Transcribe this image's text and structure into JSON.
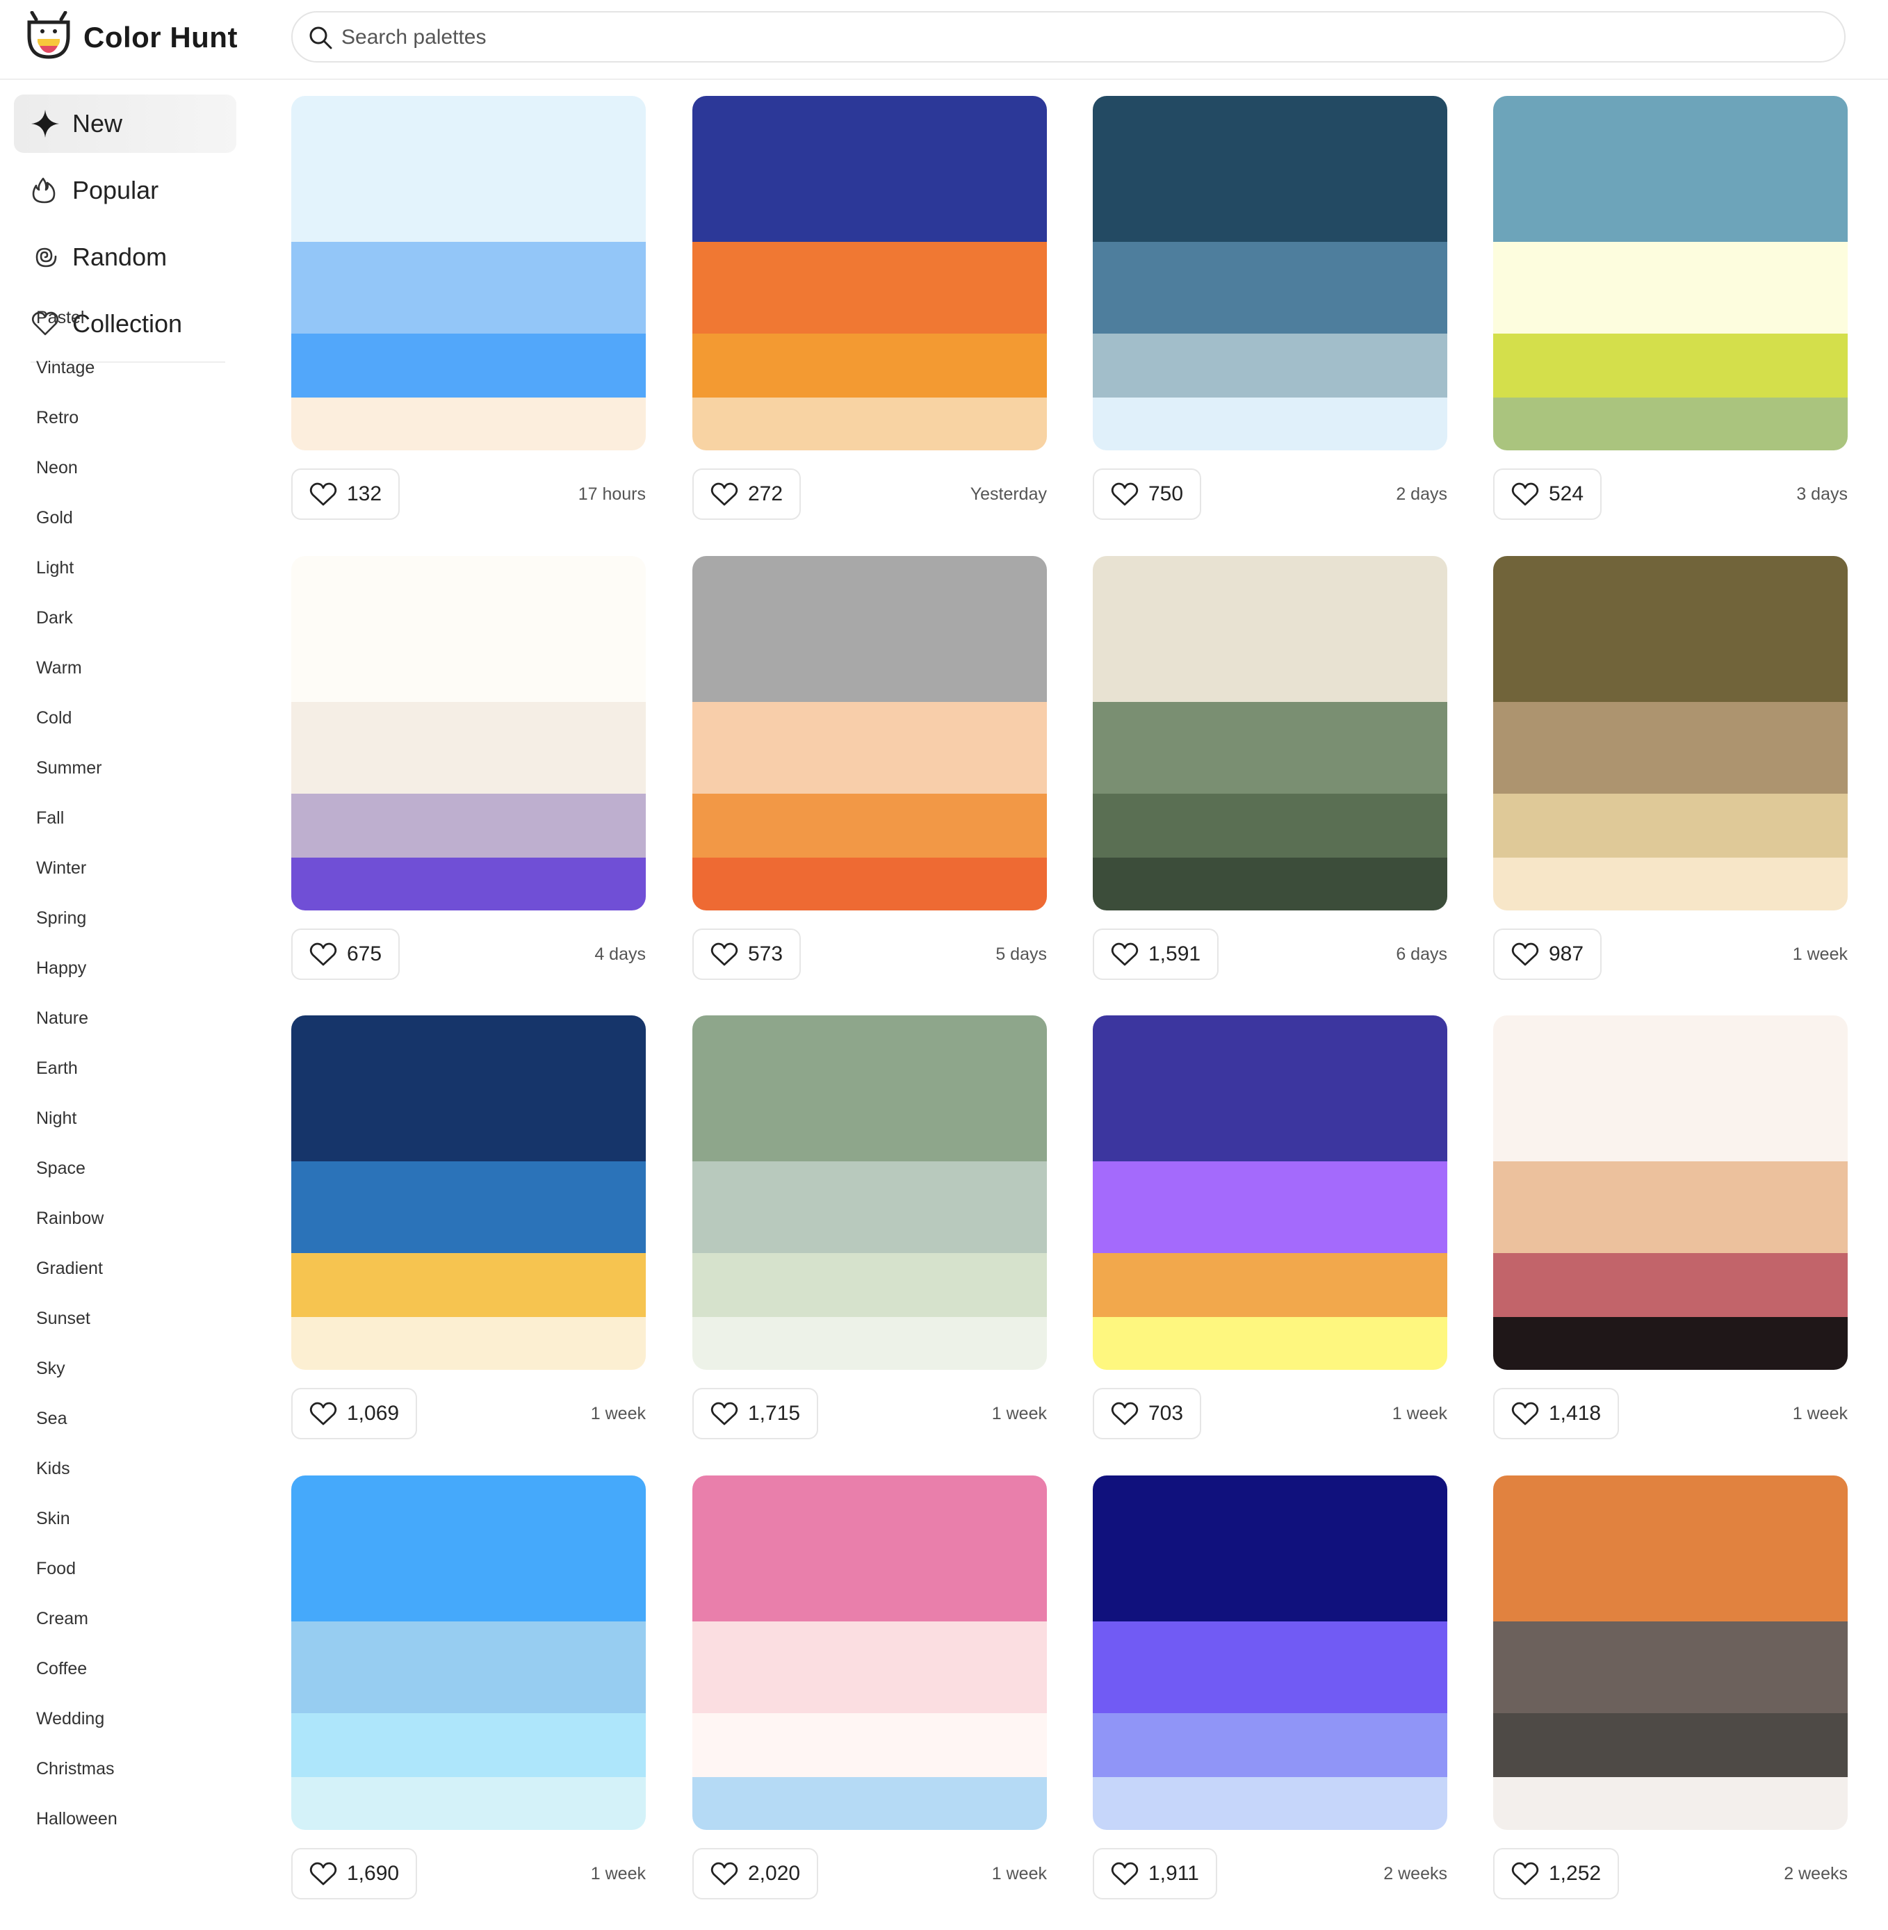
{
  "app": {
    "brand": "Color Hunt",
    "logo_icon": "color-hunt-logo-icon",
    "accent": "#222222"
  },
  "search": {
    "placeholder": "Search palettes",
    "value": ""
  },
  "nav": [
    {
      "key": "new",
      "label": "New",
      "icon": "sparkle-icon",
      "active": true
    },
    {
      "key": "popular",
      "label": "Popular",
      "icon": "flame-icon",
      "active": false
    },
    {
      "key": "random",
      "label": "Random",
      "icon": "spiral-icon",
      "active": false
    },
    {
      "key": "collection",
      "label": "Collection",
      "icon": "heart-icon",
      "active": false
    }
  ],
  "tags": [
    "Pastel",
    "Vintage",
    "Retro",
    "Neon",
    "Gold",
    "Light",
    "Dark",
    "Warm",
    "Cold",
    "Summer",
    "Fall",
    "Winter",
    "Spring",
    "Happy",
    "Nature",
    "Earth",
    "Night",
    "Space",
    "Rainbow",
    "Gradient",
    "Sunset",
    "Sky",
    "Sea",
    "Kids",
    "Skin",
    "Food",
    "Cream",
    "Coffee",
    "Wedding",
    "Christmas",
    "Halloween"
  ],
  "palettes": [
    {
      "colors": [
        "#E3F3FC",
        "#93C6F8",
        "#52A7FA",
        "#FCEEDD"
      ],
      "likes": "132",
      "ago": "17 hours"
    },
    {
      "colors": [
        "#2C3898",
        "#F07833",
        "#F39A32",
        "#F8D3A3"
      ],
      "likes": "272",
      "ago": "Yesterday"
    },
    {
      "colors": [
        "#234A63",
        "#4E7E9D",
        "#A2BECA",
        "#E0F0FA"
      ],
      "likes": "750",
      "ago": "2 days"
    },
    {
      "colors": [
        "#6DA4BA",
        "#FDFDDE",
        "#D4DF4B",
        "#AAC47E"
      ],
      "likes": "524",
      "ago": "3 days"
    },
    {
      "colors": [
        "#FEFCF7",
        "#F5EEE5",
        "#BEAFCF",
        "#704FD6"
      ],
      "likes": "675",
      "ago": "4 days"
    },
    {
      "colors": [
        "#A8A8A8",
        "#F8CEAA",
        "#F29846",
        "#EE6A33"
      ],
      "likes": "573",
      "ago": "5 days"
    },
    {
      "colors": [
        "#E8E2D2",
        "#7A8F72",
        "#5A6F53",
        "#3C4D3A"
      ],
      "likes": "1,591",
      "ago": "6 days"
    },
    {
      "colors": [
        "#71643A",
        "#AD946F",
        "#DFC998",
        "#F7E6C8"
      ],
      "likes": "987",
      "ago": "1 week"
    },
    {
      "colors": [
        "#16356A",
        "#2B73B9",
        "#F6C450",
        "#FCEFD2"
      ],
      "likes": "1,069",
      "ago": "1 week"
    },
    {
      "colors": [
        "#8EA68B",
        "#B8C9BD",
        "#D6E2CC",
        "#EDF2E8"
      ],
      "likes": "1,715",
      "ago": "1 week"
    },
    {
      "colors": [
        "#3C369F",
        "#A46AFC",
        "#F2A84C",
        "#FEF77F"
      ],
      "likes": "703",
      "ago": "1 week"
    },
    {
      "colors": [
        "#FAF3EE",
        "#ECC19D",
        "#C2646A",
        "#1F1718"
      ],
      "likes": "1,418",
      "ago": "1 week"
    },
    {
      "colors": [
        "#45A9FB",
        "#97CDF1",
        "#AEE6FB",
        "#D4F2F9"
      ],
      "likes": "1,690",
      "ago": "1 week"
    },
    {
      "colors": [
        "#E97FAB",
        "#FBDEE1",
        "#FFF6F4",
        "#B5DAF5"
      ],
      "likes": "2,020",
      "ago": "1 week"
    },
    {
      "colors": [
        "#10117D",
        "#715BF4",
        "#9095F7",
        "#C6D6FA"
      ],
      "likes": "1,911",
      "ago": "2 weeks"
    },
    {
      "colors": [
        "#E1823F",
        "#6C615C",
        "#4E4A46",
        "#F3EFEC"
      ],
      "likes": "1,252",
      "ago": "2 weeks"
    }
  ]
}
